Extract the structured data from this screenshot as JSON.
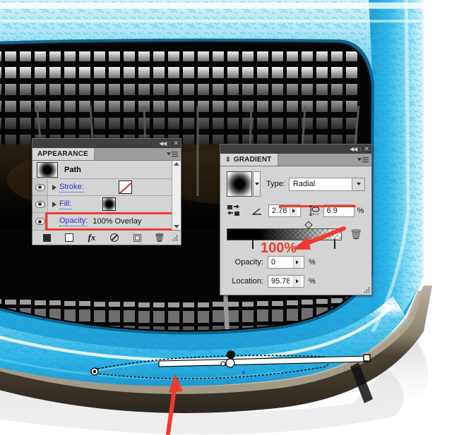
{
  "app": {
    "title": "Adobe Illustrator artwork editing"
  },
  "colors": {
    "accent_red": "#ef3b2d",
    "link_blue": "#2233cc",
    "panel_bg": "#d4d4d4",
    "panel_dark_bar": "#3f3f3f",
    "artwork_blue": "#29b6e8",
    "artwork_blue_dark": "#1b7fb5",
    "artwork_bronze": "#8d8063"
  },
  "appearance_panel": {
    "tab_label": "APPEARANCE",
    "collapse_icon": "collapse-double-arrow-icon",
    "close_icon": "close-icon",
    "menu_icon": "panel-menu-icon",
    "head": {
      "label": "Path",
      "thumbnail": "radial-gradient-thumbnail"
    },
    "rows": [
      {
        "label": "Stroke:",
        "value": "",
        "swatch": "none-swatch",
        "eye": "visibility-eye-icon",
        "disclosure": "disclosure-triangle-icon"
      },
      {
        "label": "Fill:",
        "value": "",
        "swatch": "radial-gradient-swatch",
        "eye": "visibility-eye-icon",
        "disclosure": "disclosure-triangle-icon"
      },
      {
        "label": "Opacity:",
        "value": "100% Overlay",
        "swatch": "",
        "eye": "visibility-eye-icon",
        "disclosure": ""
      }
    ],
    "highlight_row_index": 2,
    "toolbar": [
      {
        "name": "add-new-stroke-button",
        "icon": "filled-square-icon"
      },
      {
        "name": "add-new-fill-button",
        "icon": "square-icon"
      },
      {
        "name": "add-new-effect-button",
        "icon": "fx-icon"
      },
      {
        "name": "clear-appearance-button",
        "icon": "no-symbol-icon"
      },
      {
        "name": "duplicate-item-button",
        "icon": "duplicate-icon"
      },
      {
        "name": "delete-item-button",
        "icon": "trash-icon"
      }
    ],
    "scrollbar": {
      "up_icon": "scroll-up-arrow-icon",
      "down_icon": "scroll-down-arrow-icon"
    },
    "resize_grip": "resize-grip-icon"
  },
  "gradient_panel": {
    "tab_label": "GRADIENT",
    "tab_drag_icon": "drag-handle-icon",
    "collapse_icon": "collapse-double-arrow-icon",
    "close_icon": "close-icon",
    "menu_icon": "panel-menu-icon",
    "swatch": "radial-gradient-swatch",
    "swatch_dropdown_icon": "chevron-down-icon",
    "type": {
      "label": "Type:",
      "value": "Radial",
      "dropdown_icon": "chevron-down-icon",
      "underline_highlight": true
    },
    "reverse_gradient_icon": "reverse-gradient-icon",
    "angle": {
      "icon": "angle-icon",
      "value": "2.78",
      "stepper_icon": "stepper-arrow-icon",
      "unit": "°"
    },
    "aspect_ratio": {
      "icon": "aspect-ratio-icon",
      "value": "6.9",
      "unit": "%"
    },
    "ramp": {
      "midpoint_icon": "gradient-midpoint-diamond-icon",
      "stops": [
        {
          "name": "gradient-stop-start",
          "position_pct": 22,
          "kind": "black"
        },
        {
          "name": "gradient-stop-end",
          "position_pct": 95,
          "kind": "transparent",
          "selected": true
        }
      ],
      "annotation_label": "100%",
      "delete_stop_icon": "trash-icon"
    },
    "opacity": {
      "label": "Opacity:",
      "value": "0",
      "unit": "%",
      "stepper_icon": "stepper-arrow-icon"
    },
    "location": {
      "label": "Location:",
      "value": "95.78",
      "unit": "%",
      "stepper_icon": "stepper-arrow-icon"
    },
    "resize_grip": "resize-grip-icon"
  },
  "annotations": [
    {
      "name": "red-arrow-to-opacity-field",
      "kind": "arrow",
      "description": "points left to the gradient Opacity field"
    },
    {
      "name": "red-arrow-to-artwork-edge",
      "kind": "arrow",
      "description": "points up to the blue bezel edge of the artwork"
    },
    {
      "name": "red-underline-type-field",
      "kind": "underline"
    },
    {
      "name": "red-highlight-opacity-row",
      "kind": "box"
    }
  ],
  "artwork": {
    "name": "tablet-device-illustration",
    "selection": {
      "name": "gradient-annotator",
      "origin_handle": "gradient-origin-circle-handle",
      "end_handle": "gradient-end-square-handle",
      "stop_handles": [
        "gradient-stop-handle-black",
        "gradient-stop-handle-white"
      ],
      "path_outline": "dashed-selection-path"
    }
  }
}
